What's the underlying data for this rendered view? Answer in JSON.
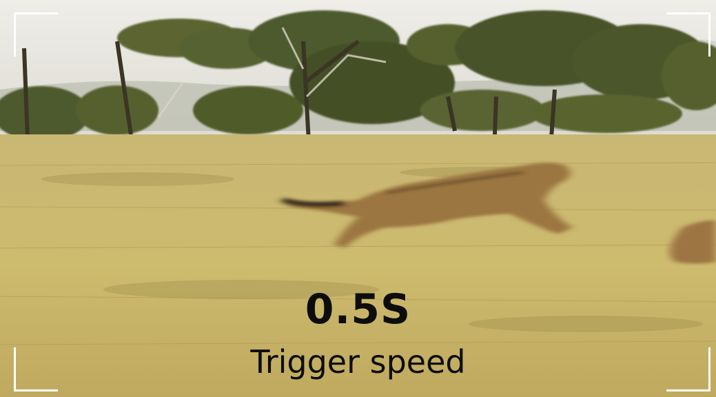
{
  "scene": {
    "subject_icon": "cheetah-running-blur",
    "colors": {
      "sky": "#e9e8e2",
      "grass": "#cdbb72",
      "trees": "#4f5a2e",
      "text": "#0d0d0d",
      "frame": "#ffffff"
    }
  },
  "overlay": {
    "value": "0.5S",
    "label": "Trigger speed"
  }
}
